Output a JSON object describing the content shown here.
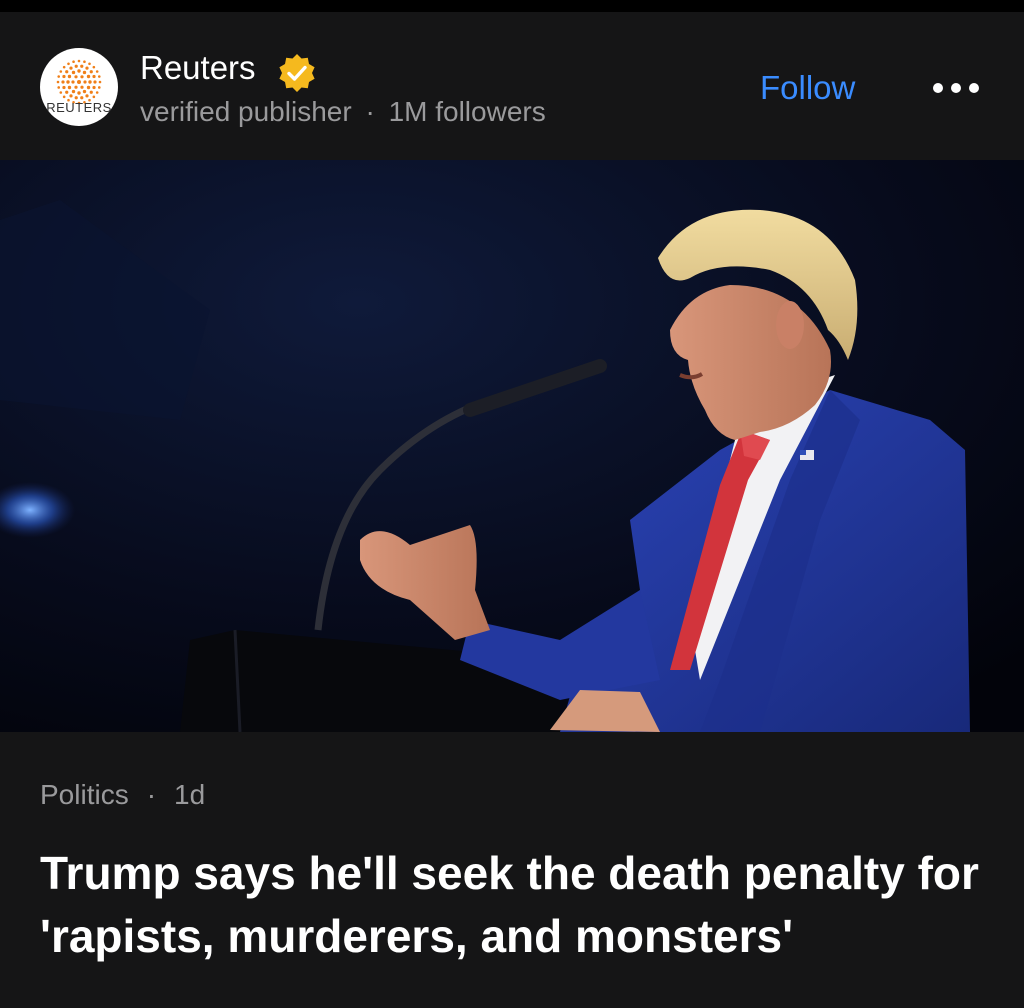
{
  "post": {
    "publisher": {
      "name": "Reuters",
      "logo_text": "REUTERS",
      "subtitle": "verified publisher",
      "followers": "1M followers",
      "separator": "·"
    },
    "follow_label": "Follow",
    "more_icon": "more-horizontal-icon",
    "verified_icon": "verified-badge-icon",
    "image": {
      "alt": "Trump speaking at a podium"
    },
    "category": "Politics",
    "meta_separator": "·",
    "age": "1d",
    "headline": "Trump says he'll seek the death penalty for 'rapists, murderers, and monsters'"
  },
  "colors": {
    "background": "#151516",
    "accent": "#3a8cff",
    "secondary_text": "#9a9a9c",
    "verified_badge": "#f5b91e",
    "logo_dots": "#f07f18"
  }
}
